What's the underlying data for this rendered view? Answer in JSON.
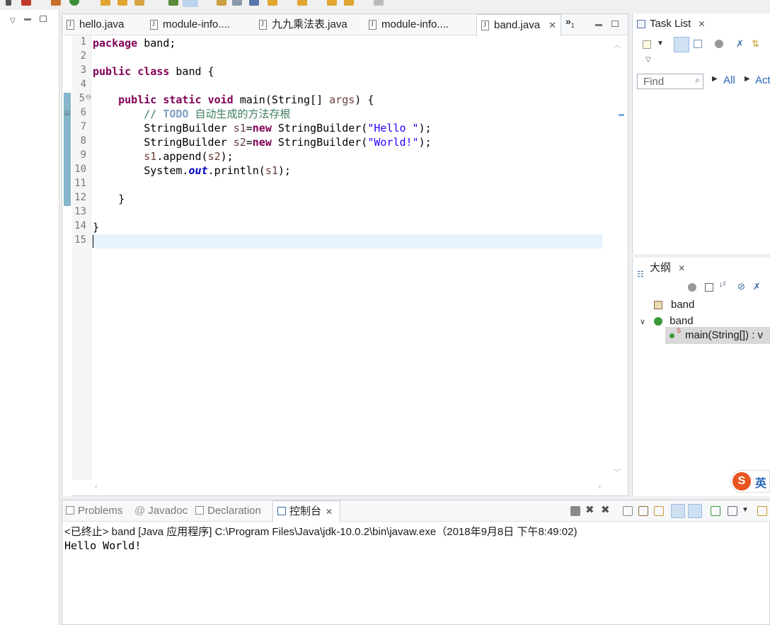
{
  "colors": {
    "keyword": "#7f0055",
    "string": "#2a00ff",
    "comment": "#3f7f5f",
    "todo": "#7f9fbf",
    "field": "#0000c0",
    "current_line": "#e8f2fe",
    "accent": "#3c78c8"
  },
  "editor": {
    "tabs": [
      {
        "label": "hello.java"
      },
      {
        "label": "module-info...."
      },
      {
        "label": "九九乘法表.java"
      },
      {
        "label": "module-info...."
      },
      {
        "label": "band.java",
        "active": true
      }
    ],
    "overflow_label": "»",
    "overflow_count": "1",
    "line_numbers": [
      "1",
      "2",
      "3",
      "4",
      "5",
      "6",
      "7",
      "8",
      "9",
      "10",
      "11",
      "12",
      "13",
      "14",
      "15"
    ],
    "code": {
      "l1_kw": "package",
      "l1_rest": " band;",
      "l3_kw1": "public",
      "l3_kw2": "class",
      "l3_rest": " band {",
      "l5_kw1": "public",
      "l5_kw2": "static",
      "l5_kw3": "void",
      "l5_mid": " main(String[] ",
      "l5_var": "args",
      "l5_end": ") {",
      "l6_cmt": "// ",
      "l6_todo": "TODO",
      "l6_text": " 自动生成的方法存根",
      "l7_a": "StringBuilder ",
      "l7_var": "s1",
      "l7_eq": "=",
      "l7_kw": "new",
      "l7_b": " StringBuilder(",
      "l7_str": "\"Hello \"",
      "l7_c": ");",
      "l8_a": "StringBuilder ",
      "l8_var": "s2",
      "l8_eq": "=",
      "l8_kw": "new",
      "l8_b": " StringBuilder(",
      "l8_str": "\"World!\"",
      "l8_c": ");",
      "l9_var1": "s1",
      "l9_mid": ".append(",
      "l9_var2": "s2",
      "l9_end": ");",
      "l10_a": "System.",
      "l10_fld": "out",
      "l10_b": ".println(",
      "l10_var": "s1",
      "l10_c": ");",
      "l12": "}",
      "l14": "}"
    }
  },
  "tasklist": {
    "title": "Task List",
    "find_placeholder": "Find",
    "all_label": "All",
    "activate_label": "Act"
  },
  "outline": {
    "title": "大纲",
    "items": [
      {
        "label": "band"
      },
      {
        "label": "band"
      },
      {
        "label": "main(String[]) : v",
        "modifier": "S"
      }
    ]
  },
  "console": {
    "tabs": [
      {
        "label": "Problems"
      },
      {
        "label": "Javadoc"
      },
      {
        "label": "Declaration"
      },
      {
        "label": "控制台",
        "active": true
      }
    ],
    "status_line": "<已终止> band [Java 应用程序] C:\\Program Files\\Java\\jdk-10.0.2\\bin\\javaw.exe（2018年9月8日 下午8:49:02)",
    "output": "Hello World!"
  },
  "ime": {
    "label": "英"
  }
}
